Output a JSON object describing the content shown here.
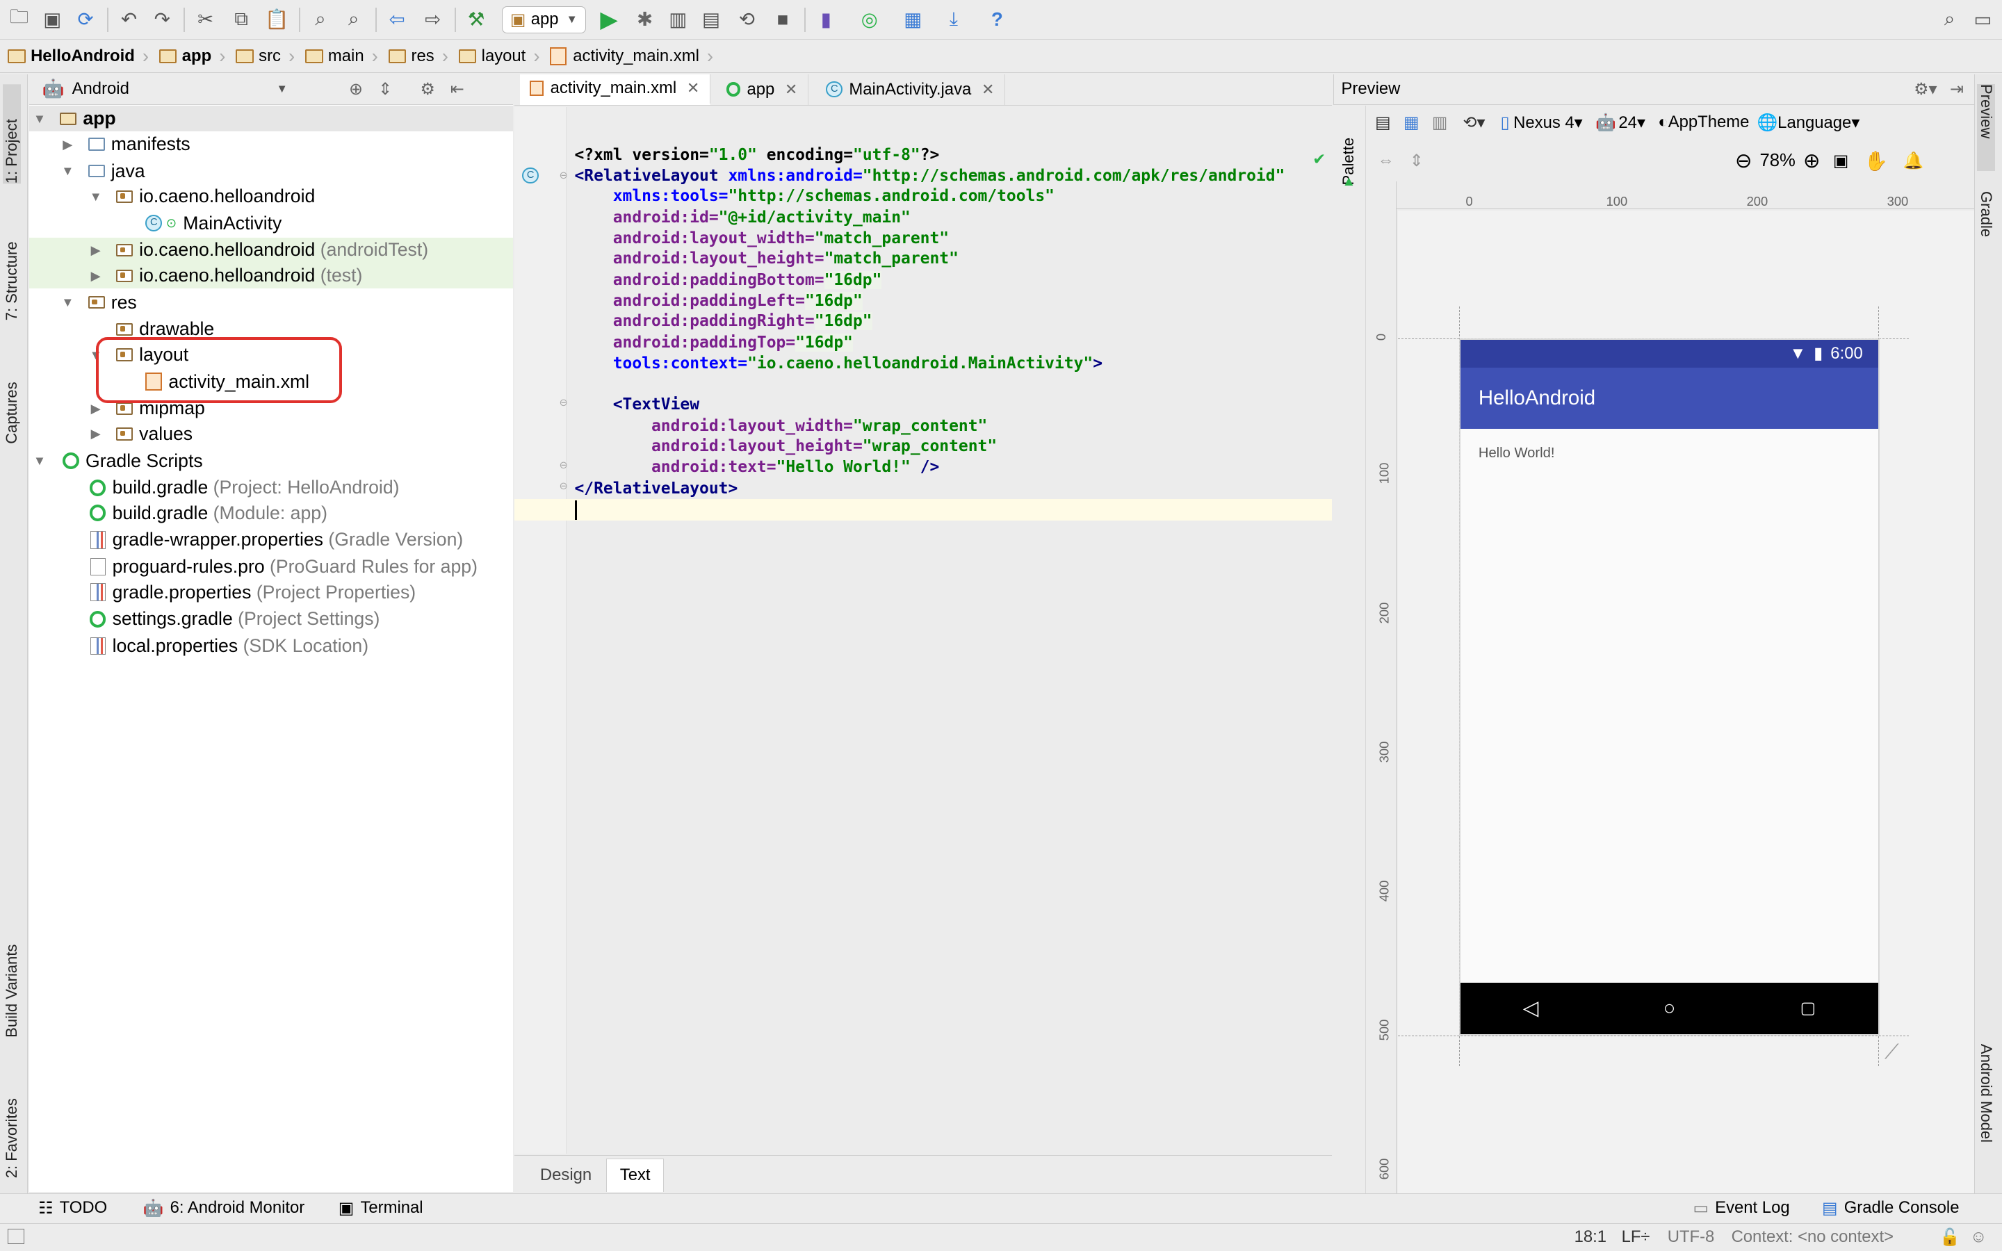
{
  "toolbar": {
    "run_config": "app"
  },
  "breadcrumb": [
    "HelloAndroid",
    "app",
    "src",
    "main",
    "res",
    "layout",
    "activity_main.xml"
  ],
  "left_strip": {
    "project": "1: Project",
    "structure": "7: Structure",
    "captures": "Captures",
    "build_variants": "Build Variants",
    "favorites": "2: Favorites"
  },
  "project_panel": {
    "view_mode": "Android"
  },
  "tree": {
    "app": "app",
    "manifests": "manifests",
    "java": "java",
    "pkg_main": "io.caeno.helloandroid",
    "main_activity": "MainActivity",
    "pkg_android_test": "io.caeno.helloandroid",
    "pkg_android_test_hint": "(androidTest)",
    "pkg_test": "io.caeno.helloandroid",
    "pkg_test_hint": "(test)",
    "res": "res",
    "drawable": "drawable",
    "layout": "layout",
    "activity_main": "activity_main.xml",
    "mipmap": "mipmap",
    "values": "values",
    "gradle_scripts": "Gradle Scripts",
    "build_gradle_project": "build.gradle",
    "build_gradle_project_hint": "(Project: HelloAndroid)",
    "build_gradle_module": "build.gradle",
    "build_gradle_module_hint": "(Module: app)",
    "gradle_wrapper": "gradle-wrapper.properties",
    "gradle_wrapper_hint": "(Gradle Version)",
    "proguard": "proguard-rules.pro",
    "proguard_hint": "(ProGuard Rules for app)",
    "gradle_props": "gradle.properties",
    "gradle_props_hint": "(Project Properties)",
    "settings_gradle": "settings.gradle",
    "settings_gradle_hint": "(Project Settings)",
    "local_props": "local.properties",
    "local_props_hint": "(SDK Location)"
  },
  "editor_tabs": [
    "activity_main.xml",
    "app",
    "MainActivity.java"
  ],
  "code": {
    "l1a": "<?xml version=",
    "l1b": "\"1.0\"",
    "l1c": " encoding=",
    "l1d": "\"utf-8\"",
    "l1e": "?>",
    "l2a": "<RelativeLayout ",
    "l2b": "xmlns:android=",
    "l2c": "\"http://schemas.android.com/apk/res/android\"",
    "l3a": "    xmlns:tools=",
    "l3b": "\"http://schemas.android.com/tools\"",
    "l4a": "    android:id=",
    "l4b": "\"@+id/activity_main\"",
    "l5a": "    android:layout_width=",
    "l5b": "\"match_parent\"",
    "l6a": "    android:layout_height=",
    "l6b": "\"match_parent\"",
    "l7a": "    android:paddingBottom=",
    "l7b": "\"16dp\"",
    "l8a": "    android:paddingLeft=",
    "l8b": "\"16dp\"",
    "l9a": "    android:paddingRight=",
    "l9b": "\"16dp\"",
    "l10a": "    android:paddingTop=",
    "l10b": "\"16dp\"",
    "l11a": "    tools:context=",
    "l11b": "\"io.caeno.helloandroid.MainActivity\"",
    "l11c": ">",
    "l13a": "    <TextView",
    "l14a": "        android:layout_width=",
    "l14b": "\"wrap_content\"",
    "l15a": "        android:layout_height=",
    "l15b": "\"wrap_content\"",
    "l16a": "        android:text=",
    "l16b": "\"Hello World!\"",
    "l16c": " />",
    "l17a": "</RelativeLayout>"
  },
  "editor_bottom_tabs": {
    "design": "Design",
    "text": "Text"
  },
  "preview": {
    "title": "Preview",
    "palette": "Palette",
    "device": "Nexus 4",
    "api": "24",
    "theme": "AppTheme",
    "language": "Language",
    "zoom": "78%",
    "ruler_top": [
      "0",
      "100",
      "200",
      "300"
    ],
    "ruler_left": [
      "0",
      "100",
      "200",
      "300",
      "400",
      "500",
      "600"
    ],
    "phone": {
      "time": "6:00",
      "app_title": "HelloAndroid",
      "text": "Hello World!"
    }
  },
  "right_strip": {
    "preview": "Preview",
    "gradle": "Gradle",
    "android_model": "Android Model"
  },
  "bottom_bar": {
    "todo": "TODO",
    "monitor": "6: Android Monitor",
    "terminal": "Terminal",
    "event_log": "Event Log",
    "gradle_console": "Gradle Console"
  },
  "status": {
    "position": "18:1",
    "line_sep": "LF÷",
    "encoding": "UTF-8",
    "context": "Context: <no context>"
  },
  "colors": {
    "status_bar": "#303f9f",
    "app_bar": "#3f51b5",
    "highlight_box": "#e0312c"
  }
}
